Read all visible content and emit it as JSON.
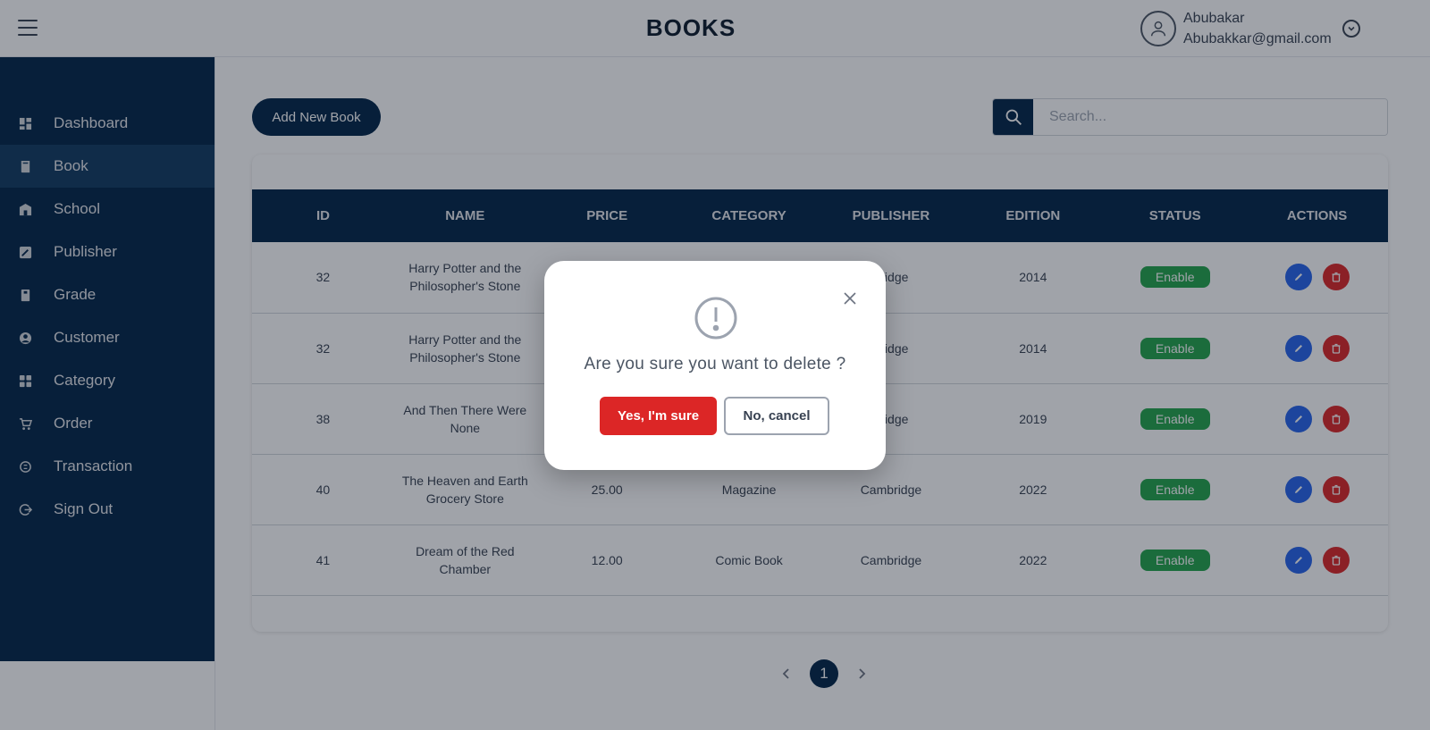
{
  "header": {
    "title": "BOOKS",
    "user_name": "Abubakar",
    "user_email": "Abubakkar@gmail.com"
  },
  "sidebar": {
    "items": [
      {
        "label": "Dashboard",
        "icon": "dashboard-icon"
      },
      {
        "label": "Book",
        "icon": "book-icon",
        "active": true
      },
      {
        "label": "School",
        "icon": "school-icon"
      },
      {
        "label": "Publisher",
        "icon": "publisher-icon"
      },
      {
        "label": "Grade",
        "icon": "grade-icon"
      },
      {
        "label": "Customer",
        "icon": "customer-icon"
      },
      {
        "label": "Category",
        "icon": "category-icon"
      },
      {
        "label": "Order",
        "icon": "cart-icon"
      },
      {
        "label": "Transaction",
        "icon": "transaction-icon"
      },
      {
        "label": "Sign Out",
        "icon": "sign-out-icon"
      }
    ]
  },
  "toolbar": {
    "add_label": "Add New Book",
    "search_placeholder": "Search..."
  },
  "table": {
    "columns": [
      "ID",
      "NAME",
      "PRICE",
      "CATEGORY",
      "PUBLISHER",
      "EDITION",
      "STATUS",
      "ACTIONS"
    ],
    "rows": [
      {
        "id": "32",
        "name": "Harry Potter and the Philosopher's Stone",
        "price": "",
        "category": "",
        "publisher": "bridge",
        "edition": "2014",
        "status": "Enable"
      },
      {
        "id": "32",
        "name": "Harry Potter and the Philosopher's Stone",
        "price": "",
        "category": "",
        "publisher": "bridge",
        "edition": "2014",
        "status": "Enable"
      },
      {
        "id": "38",
        "name": "And Then There Were None",
        "price": "",
        "category": "",
        "publisher": "bridge",
        "edition": "2019",
        "status": "Enable"
      },
      {
        "id": "40",
        "name": "The Heaven and Earth Grocery Store",
        "price": "25.00",
        "category": "Magazine",
        "publisher": "Cambridge",
        "edition": "2022",
        "status": "Enable"
      },
      {
        "id": "41",
        "name": "Dream of the Red Chamber",
        "price": "12.00",
        "category": "Comic Book",
        "publisher": "Cambridge",
        "edition": "2022",
        "status": "Enable"
      }
    ]
  },
  "pagination": {
    "current_page": "1"
  },
  "modal": {
    "message": "Are you sure you want to delete ?",
    "confirm_label": "Yes, I'm sure",
    "cancel_label": "No, cancel"
  },
  "colors": {
    "brand_navy": "#002447",
    "danger": "#dc2626",
    "success": "#22a34a",
    "edit_blue": "#2563eb"
  }
}
